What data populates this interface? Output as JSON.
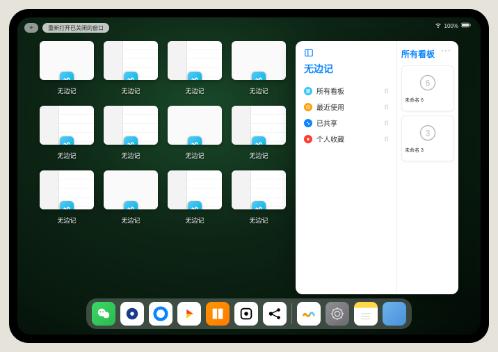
{
  "status": {
    "battery": "100%",
    "wifi": true
  },
  "topbar": {
    "plus": "+",
    "reopen_label": "重新打开已关闭的窗口"
  },
  "tile_app_label": "无边记",
  "tiles": [
    {
      "variant": "blank"
    },
    {
      "variant": "grid"
    },
    {
      "variant": "grid"
    },
    {
      "variant": "blank"
    },
    {
      "variant": "grid"
    },
    {
      "variant": "grid"
    },
    {
      "variant": "blank"
    },
    {
      "variant": "grid"
    },
    {
      "variant": "grid"
    },
    {
      "variant": "blank"
    },
    {
      "variant": "grid"
    },
    {
      "variant": "grid"
    }
  ],
  "window": {
    "app_title": "无边记",
    "ellipsis": "···",
    "items": [
      {
        "label": "所有看板",
        "count": "0",
        "color": "#34c5ff"
      },
      {
        "label": "最近使用",
        "count": "0",
        "color": "#ff9f0a"
      },
      {
        "label": "已共享",
        "count": "0",
        "color": "#0a84ff"
      },
      {
        "label": "个人收藏",
        "count": "0",
        "color": "#ff3b30"
      }
    ],
    "right_title": "所有看板",
    "boards": [
      {
        "name": "未命名 6",
        "glyph": "6"
      },
      {
        "name": "未命名 3",
        "glyph": "3"
      }
    ]
  },
  "dock": [
    {
      "name": "wechat"
    },
    {
      "name": "qb-blue"
    },
    {
      "name": "qb-cyan"
    },
    {
      "name": "play"
    },
    {
      "name": "books"
    },
    {
      "name": "dice"
    },
    {
      "name": "nodes"
    },
    {
      "name": "freeform"
    },
    {
      "name": "settings"
    },
    {
      "name": "notes"
    },
    {
      "name": "app-folder"
    }
  ]
}
